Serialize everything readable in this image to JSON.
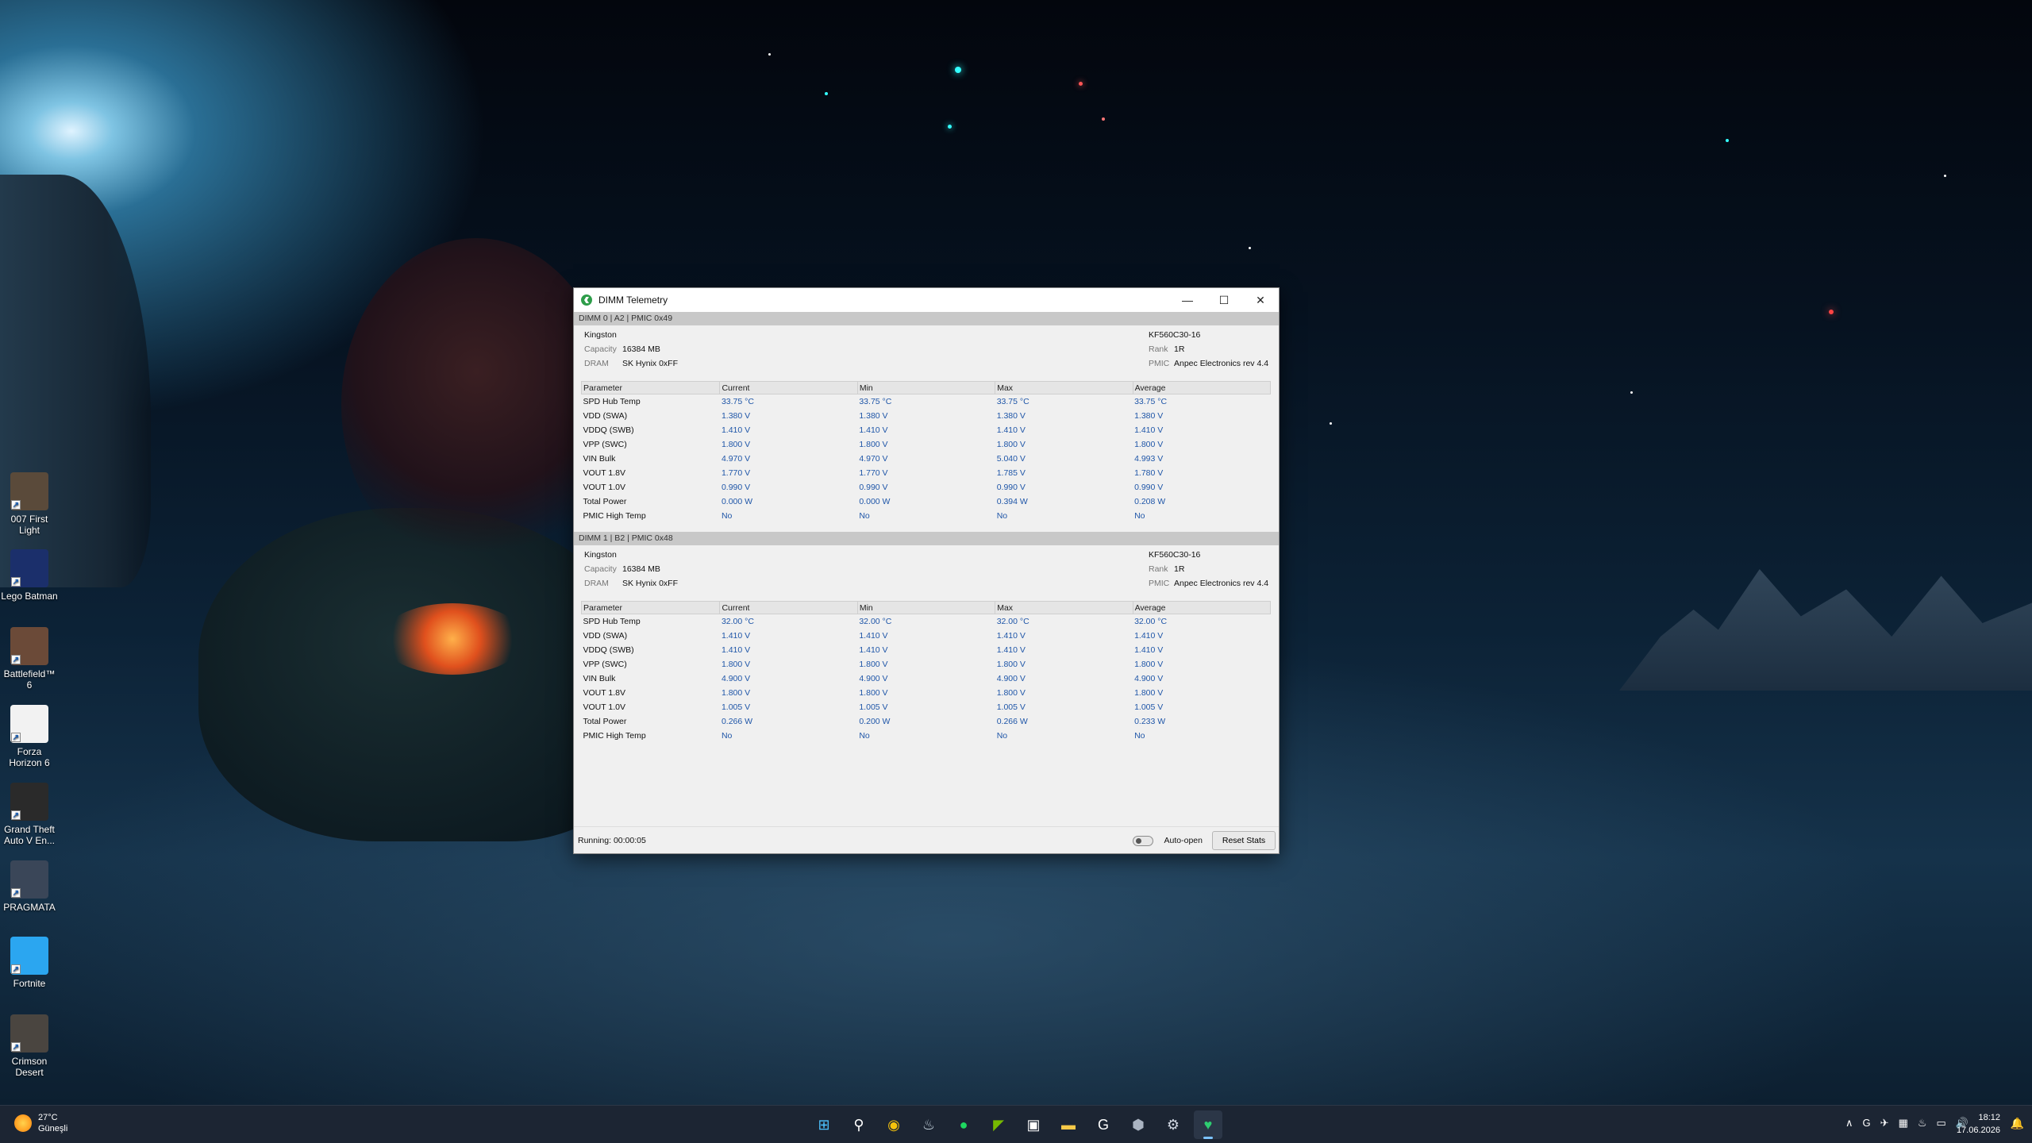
{
  "desktop": {
    "icons": [
      {
        "label": "007 First\nLight",
        "icon": "007-game-icon",
        "color": "#5a4a3a"
      },
      {
        "label": "Lego Batman",
        "icon": "lego-batman-icon",
        "color": "#1b2f6b"
      },
      {
        "label": "Battlefield™ 6",
        "icon": "battlefield-icon",
        "color": "#6b4a38"
      },
      {
        "label": "Forza\nHorizon 6",
        "icon": "forza-icon",
        "color": "#f2f2f2"
      },
      {
        "label": "Grand Theft\nAuto V En...",
        "icon": "gta-icon",
        "color": "#2a2a2a"
      },
      {
        "label": "PRAGMATA",
        "icon": "pragmata-icon",
        "color": "#3a4658"
      },
      {
        "label": "Fortnite",
        "icon": "fortnite-icon",
        "color": "#2ba6f0"
      },
      {
        "label": "Crimson\nDesert",
        "icon": "crimson-desert-icon",
        "color": "#4a4540"
      }
    ]
  },
  "window": {
    "title": "DIMM Telemetry",
    "minimize": "—",
    "maximize": "☐",
    "close": "✕",
    "columns": [
      "Parameter",
      "Current",
      "Min",
      "Max",
      "Average"
    ],
    "dimms": [
      {
        "header": "DIMM 0 | A2 | PMIC 0x49",
        "vendor": "Kingston",
        "capacity_label": "Capacity",
        "capacity": "16384 MB",
        "dram_label": "DRAM",
        "dram": "SK Hynix 0xFF",
        "part": "KF560C30-16",
        "rank_label": "Rank",
        "rank": "1R",
        "pmic_label": "PMIC",
        "pmic": "Anpec Electronics rev 4.4",
        "rows": [
          [
            "SPD Hub Temp",
            "33.75 °C",
            "33.75 °C",
            "33.75 °C",
            "33.75 °C"
          ],
          [
            "VDD (SWA)",
            "1.380 V",
            "1.380 V",
            "1.380 V",
            "1.380 V"
          ],
          [
            "VDDQ (SWB)",
            "1.410 V",
            "1.410 V",
            "1.410 V",
            "1.410 V"
          ],
          [
            "VPP (SWC)",
            "1.800 V",
            "1.800 V",
            "1.800 V",
            "1.800 V"
          ],
          [
            "VIN Bulk",
            "4.970 V",
            "4.970 V",
            "5.040 V",
            "4.993 V"
          ],
          [
            "VOUT 1.8V",
            "1.770 V",
            "1.770 V",
            "1.785 V",
            "1.780 V"
          ],
          [
            "VOUT 1.0V",
            "0.990 V",
            "0.990 V",
            "0.990 V",
            "0.990 V"
          ],
          [
            "Total Power",
            "0.000 W",
            "0.000 W",
            "0.394 W",
            "0.208 W"
          ],
          [
            "PMIC High Temp",
            "No",
            "No",
            "No",
            "No"
          ]
        ]
      },
      {
        "header": "DIMM 1 | B2 | PMIC 0x48",
        "vendor": "Kingston",
        "capacity_label": "Capacity",
        "capacity": "16384 MB",
        "dram_label": "DRAM",
        "dram": "SK Hynix 0xFF",
        "part": "KF560C30-16",
        "rank_label": "Rank",
        "rank": "1R",
        "pmic_label": "PMIC",
        "pmic": "Anpec Electronics rev 4.4",
        "rows": [
          [
            "SPD Hub Temp",
            "32.00 °C",
            "32.00 °C",
            "32.00 °C",
            "32.00 °C"
          ],
          [
            "VDD (SWA)",
            "1.410 V",
            "1.410 V",
            "1.410 V",
            "1.410 V"
          ],
          [
            "VDDQ (SWB)",
            "1.410 V",
            "1.410 V",
            "1.410 V",
            "1.410 V"
          ],
          [
            "VPP (SWC)",
            "1.800 V",
            "1.800 V",
            "1.800 V",
            "1.800 V"
          ],
          [
            "VIN Bulk",
            "4.900 V",
            "4.900 V",
            "4.900 V",
            "4.900 V"
          ],
          [
            "VOUT 1.8V",
            "1.800 V",
            "1.800 V",
            "1.800 V",
            "1.800 V"
          ],
          [
            "VOUT 1.0V",
            "1.005 V",
            "1.005 V",
            "1.005 V",
            "1.005 V"
          ],
          [
            "Total Power",
            "0.266 W",
            "0.200 W",
            "0.266 W",
            "0.233 W"
          ],
          [
            "PMIC High Temp",
            "No",
            "No",
            "No",
            "No"
          ]
        ]
      }
    ],
    "status": {
      "running": "Running: 00:00:05",
      "auto_open": "Auto-open",
      "auto_open_on": false,
      "reset_label": "Reset Stats"
    }
  },
  "taskbar": {
    "weather_temp": "27°C",
    "weather_desc": "Güneşli",
    "apps": [
      {
        "name": "start-icon",
        "glyph": "⊞",
        "color": "#4cc2ff"
      },
      {
        "name": "search-icon",
        "glyph": "⚲",
        "color": "#ffffff"
      },
      {
        "name": "chrome-icon",
        "glyph": "◉",
        "color": "#f4c20d"
      },
      {
        "name": "steam-icon",
        "glyph": "♨",
        "color": "#c7d5e0"
      },
      {
        "name": "spotify-icon",
        "glyph": "●",
        "color": "#1ed760"
      },
      {
        "name": "nvidia-icon",
        "glyph": "◤",
        "color": "#76b900"
      },
      {
        "name": "store-icon",
        "glyph": "▣",
        "color": "#ffffff"
      },
      {
        "name": "file-explorer-icon",
        "glyph": "▬",
        "color": "#f7c948"
      },
      {
        "name": "g-hub-icon",
        "glyph": "G",
        "color": "#ffffff"
      },
      {
        "name": "app-hex-icon",
        "glyph": "⬢",
        "color": "#aab4c2"
      },
      {
        "name": "settings-icon",
        "glyph": "⚙",
        "color": "#d0d7e2"
      },
      {
        "name": "dimm-telemetry-icon",
        "glyph": "♥",
        "color": "#2ecc71"
      }
    ],
    "tray": [
      {
        "name": "chevron-up-icon",
        "glyph": "∧"
      },
      {
        "name": "g-hub-tray-icon",
        "glyph": "G"
      },
      {
        "name": "plane-tray-icon",
        "glyph": "✈"
      },
      {
        "name": "app-tray-icon",
        "glyph": "▦"
      },
      {
        "name": "steam-tray-icon",
        "glyph": "♨"
      },
      {
        "name": "network-icon",
        "glyph": "▭"
      },
      {
        "name": "volume-icon",
        "glyph": "🔊"
      }
    ],
    "time": "18:12",
    "date": "17.06.2026",
    "notification_glyph": "🔔"
  }
}
